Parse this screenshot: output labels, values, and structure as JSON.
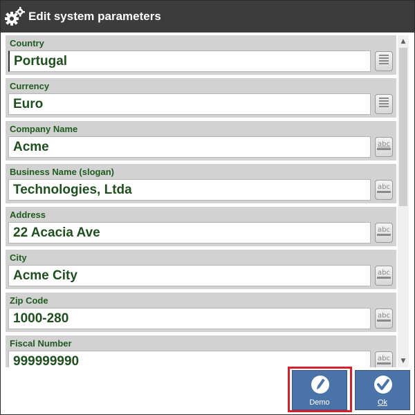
{
  "window": {
    "title": "Edit system parameters",
    "title_icon": "gears-icon"
  },
  "fields": [
    {
      "label": "Country",
      "value": "Portugal",
      "button_icon": "list-icon"
    },
    {
      "label": "Currency",
      "value": "Euro",
      "button_icon": "list-icon"
    },
    {
      "label": "Company Name",
      "value": "Acme",
      "button_icon": "abc-keyboard-icon"
    },
    {
      "label": "Business Name (slogan)",
      "value": "Technologies, Ltda",
      "button_icon": "abc-keyboard-icon"
    },
    {
      "label": "Address",
      "value": "22 Acacia Ave",
      "button_icon": "abc-keyboard-icon"
    },
    {
      "label": "City",
      "value": "Acme City",
      "button_icon": "abc-keyboard-icon"
    },
    {
      "label": "Zip Code",
      "value": "1000-280",
      "button_icon": "abc-keyboard-icon"
    },
    {
      "label": "Fiscal Number",
      "value": "999999990",
      "button_icon": "abc-keyboard-icon"
    }
  ],
  "buttons": {
    "demo": {
      "label": "Demo",
      "icon": "pencil-icon"
    },
    "ok": {
      "label": "Ok",
      "icon": "checkmark-icon"
    }
  },
  "colors": {
    "titlebar": "#3c3c3c",
    "field_label": "#1f5a1f",
    "field_value": "#1f4f1f",
    "button": "#4a73a8",
    "highlight": "#d6202e"
  }
}
